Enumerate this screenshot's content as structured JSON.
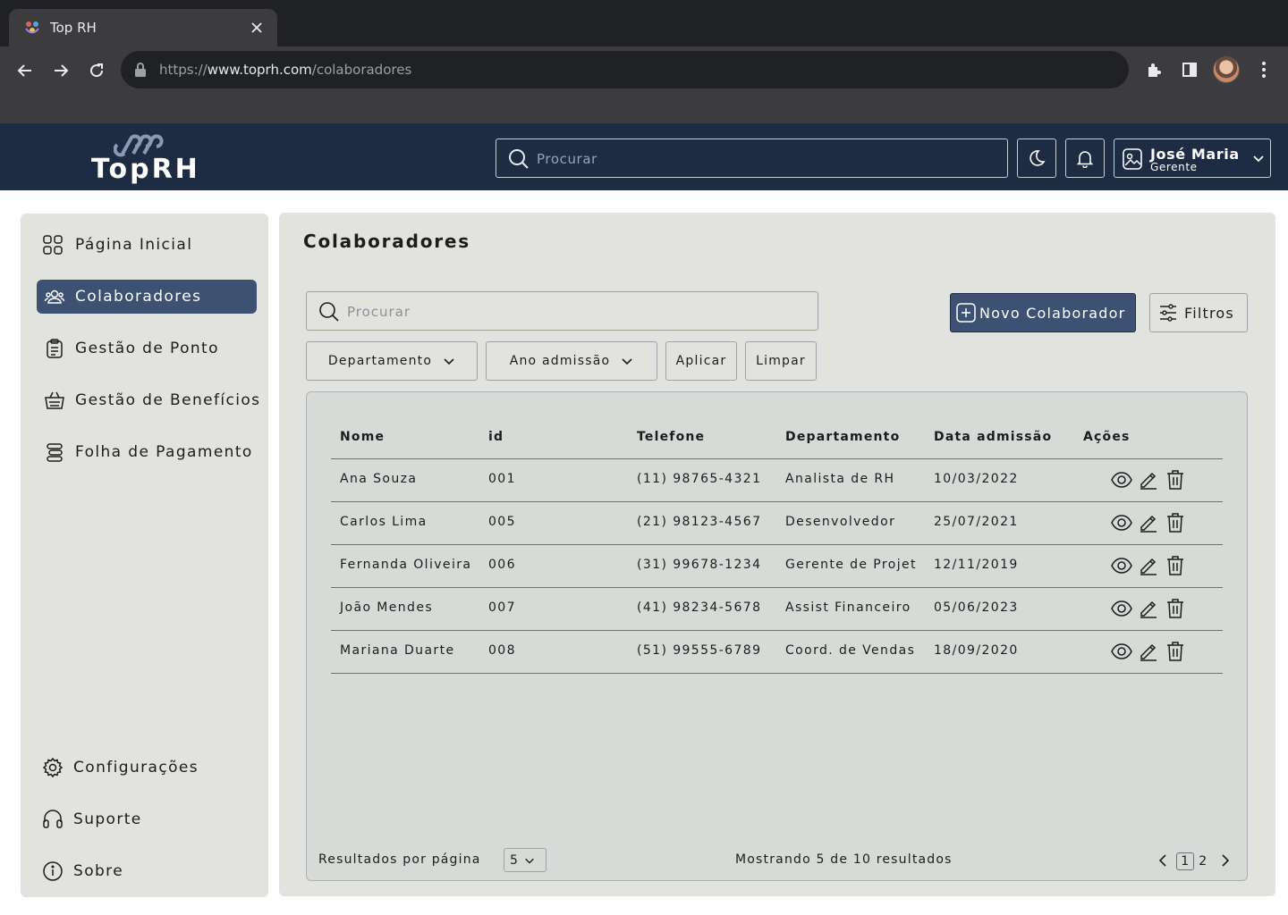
{
  "browser": {
    "tab_title": "Top RH",
    "url_scheme": "https://",
    "url_host": "www.toprh.com",
    "url_path": "/colaboradores"
  },
  "header": {
    "logo_text": "TopRH",
    "search_placeholder": "Procurar",
    "user_name": "José Maria",
    "user_role": "Gerente"
  },
  "sidebar": {
    "items": [
      {
        "label": "Página Inicial",
        "icon": "grid-icon"
      },
      {
        "label": "Colaboradores",
        "icon": "users-icon",
        "active": true
      },
      {
        "label": "Gestão de Ponto",
        "icon": "clipboard-icon"
      },
      {
        "label": "Gestão de Benefícios",
        "icon": "basket-icon"
      },
      {
        "label": "Folha de Pagamento",
        "icon": "coins-icon"
      }
    ],
    "bottom_items": [
      {
        "label": "Configurações",
        "icon": "gear-icon"
      },
      {
        "label": "Suporte",
        "icon": "headset-icon"
      },
      {
        "label": "Sobre",
        "icon": "info-icon"
      }
    ]
  },
  "main": {
    "title": "Colaboradores",
    "search_placeholder": "Procurar",
    "new_button": "Novo Colaborador",
    "filters_button": "Filtros",
    "filter_department": "Departamento",
    "filter_year": "Ano admissão",
    "apply_button": "Aplicar",
    "clear_button": "Limpar"
  },
  "table": {
    "headers": [
      "Nome",
      "id",
      "Telefone",
      "Departamento",
      "Data admissão",
      "Ações"
    ],
    "rows": [
      [
        "Ana Souza",
        "001",
        "(11) 98765-4321",
        "Analista de RH",
        "10/03/2022"
      ],
      [
        "Carlos Lima",
        "005",
        "(21) 98123-4567",
        "Desenvolvedor",
        "25/07/2021"
      ],
      [
        "Fernanda Oliveira",
        "006",
        "(31) 99678-1234",
        "Gerente de Projet",
        "12/11/2019"
      ],
      [
        "João Mendes",
        "007",
        "(41) 98234-5678",
        "Assist Financeiro",
        "05/06/2023"
      ],
      [
        "Mariana Duarte",
        "008",
        "(51) 99555-6789",
        "Coord. de Vendas",
        "18/09/2020"
      ]
    ]
  },
  "footer": {
    "per_page_label": "Resultados por página",
    "per_page_value": "5",
    "count_text": "Mostrando 5 de 10 resultados",
    "pages": [
      "1",
      "2"
    ],
    "current_page": "1"
  },
  "colors": {
    "header_bg": "#1d2b43",
    "accent": "#3d5273",
    "panel_bg": "#e2e2de",
    "table_bg": "#d7dbd7"
  }
}
